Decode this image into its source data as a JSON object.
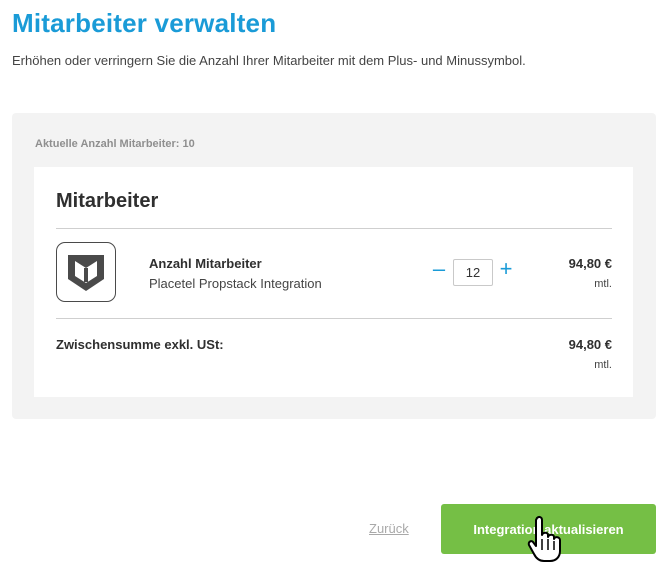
{
  "page": {
    "title": "Mitarbeiter verwalten",
    "subtitle": "Erhöhen oder verringern Sie die Anzahl Ihrer Mitarbeiter mit dem Plus- und Minussymbol."
  },
  "summary": {
    "current_count_label": "Aktuelle Anzahl Mitarbeiter: 10"
  },
  "card": {
    "title": "Mitarbeiter",
    "item": {
      "logo_icon": "shield-logo-icon",
      "name": "Anzahl Mitarbeiter",
      "description": "Placetel Propstack Integration",
      "quantity": "12",
      "minus_symbol": "–",
      "plus_symbol": "+",
      "price": "94,80 €",
      "period": "mtl."
    },
    "subtotal": {
      "label": "Zwischensumme exkl. USt:",
      "price": "94,80 €",
      "period": "mtl."
    }
  },
  "footer": {
    "back_label": "Zurück",
    "submit_label": "Integration aktualisieren"
  },
  "colors": {
    "title_accent": "#1a9bd7",
    "button_green": "#75bf45",
    "panel_bg": "#f3f3f3"
  },
  "cursor_icon": "hand-pointer-icon"
}
